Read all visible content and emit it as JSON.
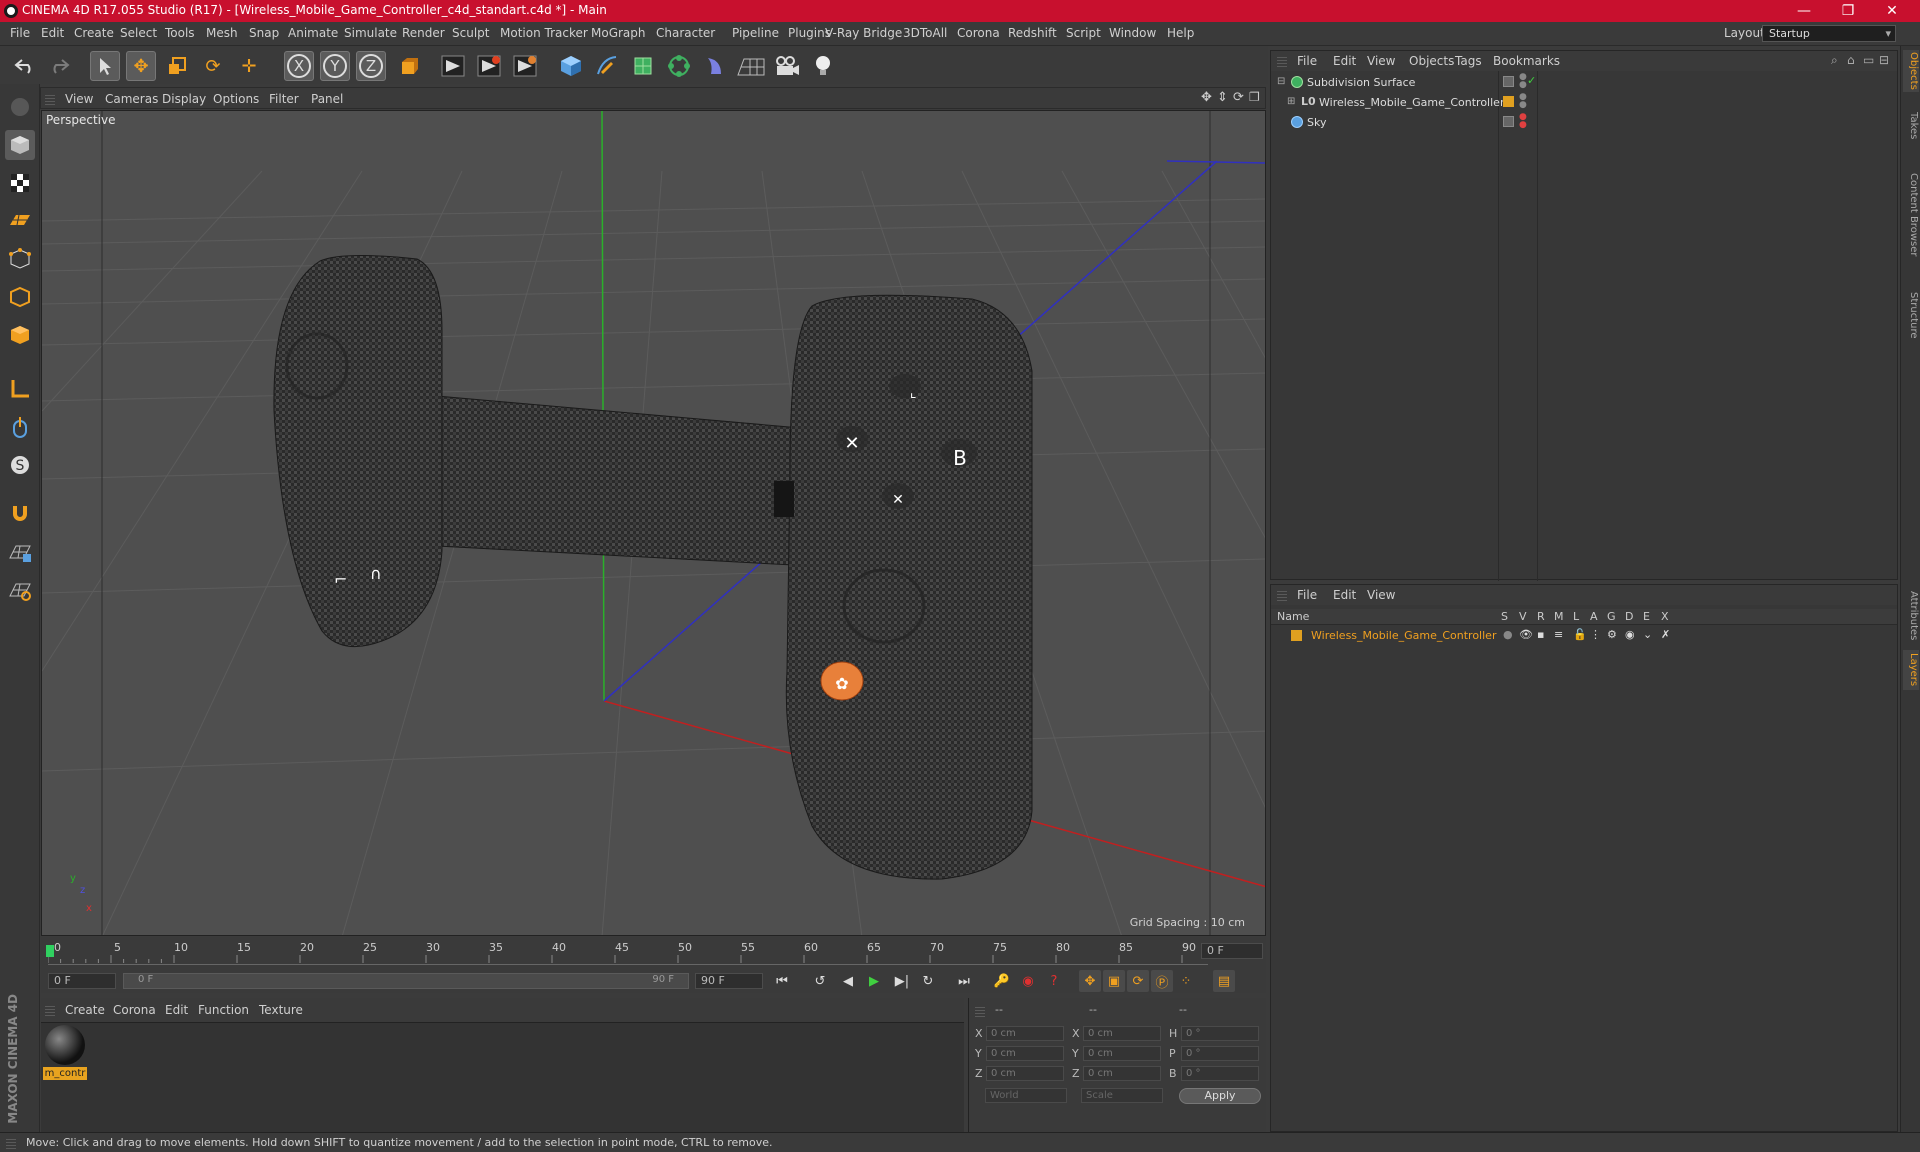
{
  "window": {
    "title": "CINEMA 4D R17.055 Studio (R17) - [Wireless_Mobile_Game_Controller_c4d_standart.c4d *] - Main",
    "minimize": "—",
    "maximize": "❐",
    "close": "✕"
  },
  "menubar": {
    "items": [
      "File",
      "Edit",
      "Create",
      "Select",
      "Tools",
      "Mesh",
      "Snap",
      "Animate",
      "Simulate",
      "Render",
      "Sculpt",
      "Motion Tracker",
      "MoGraph",
      "Character",
      "Pipeline",
      "Plugins",
      "V-Ray Bridge",
      "3DToAll",
      "Corona",
      "Redshift",
      "Script",
      "Window",
      "Help"
    ],
    "layout_label": "Layout:",
    "layout_value": "Startup"
  },
  "toolbar": {
    "icons": [
      "undo-icon",
      "redo-icon",
      "select-arrow-icon",
      "move-icon",
      "scale-icon",
      "rotate-icon",
      "live-select-icon",
      "x-axis-icon",
      "y-axis-icon",
      "z-axis-icon",
      "coordinate-system-icon",
      "render-view-icon",
      "render-picture-icon",
      "render-settings-icon",
      "cube-icon",
      "pen-icon",
      "subdivision-icon",
      "array-icon",
      "deformer-icon",
      "floor-icon",
      "camera-icon",
      "light-icon"
    ],
    "axis_x": "X",
    "axis_y": "Y",
    "axis_z": "Z"
  },
  "viewport": {
    "menu": [
      "View",
      "Cameras",
      "Display",
      "Options",
      "Filter",
      "Panel"
    ],
    "label": "Perspective",
    "grid_spacing": "Grid Spacing : 10 cm",
    "axis_y": "y",
    "axis_z": "z",
    "axis_x": "x"
  },
  "timeline": {
    "ticks": [
      "0",
      "5",
      "10",
      "15",
      "20",
      "25",
      "30",
      "35",
      "40",
      "45",
      "50",
      "55",
      "60",
      "65",
      "70",
      "75",
      "80",
      "85",
      "90"
    ],
    "current_frame": "0 F",
    "start_field": "0 F",
    "range_start": "0 F",
    "range_end": "90 F",
    "end_field": "90 F"
  },
  "material_manager": {
    "menu": [
      "Create",
      "Corona",
      "Edit",
      "Function",
      "Texture"
    ],
    "material_name": "m_contr"
  },
  "coordinates": {
    "headers": [
      "--",
      "--",
      "--"
    ],
    "rows": [
      {
        "l1": "X",
        "v1": "0 cm",
        "l2": "X",
        "v2": "0 cm",
        "l3": "H",
        "v3": "0 °"
      },
      {
        "l1": "Y",
        "v1": "0 cm",
        "l2": "Y",
        "v2": "0 cm",
        "l3": "P",
        "v3": "0 °"
      },
      {
        "l1": "Z",
        "v1": "0 cm",
        "l2": "Z",
        "v2": "0 cm",
        "l3": "B",
        "v3": "0 °"
      }
    ],
    "world": "World",
    "scale": "Scale",
    "apply": "Apply"
  },
  "object_manager": {
    "menu": [
      "File",
      "Edit",
      "View",
      "Objects",
      "Tags",
      "Bookmarks"
    ],
    "objects": [
      {
        "name": "Subdivision Surface",
        "color": "#888888"
      },
      {
        "name": "Wireless_Mobile_Game_Controller",
        "color": "#e0a020"
      },
      {
        "name": "Sky",
        "color": "#888888"
      }
    ]
  },
  "layer_manager": {
    "menu": [
      "File",
      "Edit",
      "View"
    ],
    "columns": [
      "Name",
      "S",
      "V",
      "R",
      "M",
      "L",
      "A",
      "G",
      "D",
      "E",
      "X"
    ],
    "layer_name": "Wireless_Mobile_Game_Controller",
    "layer_color": "#e0a020"
  },
  "right_tabs": [
    "Objects",
    "Takes",
    "Content Browser",
    "Structure",
    "Attributes",
    "Layers"
  ],
  "status": {
    "text": "Move: Click and drag to move elements. Hold down SHIFT to quantize movement / add to the selection in point mode, CTRL to remove."
  },
  "brand": "MAXON CINEMA 4D",
  "colors": {
    "accent": "#c8102e",
    "highlight": "#f0a020",
    "selected_layer": "#e8a31f"
  }
}
